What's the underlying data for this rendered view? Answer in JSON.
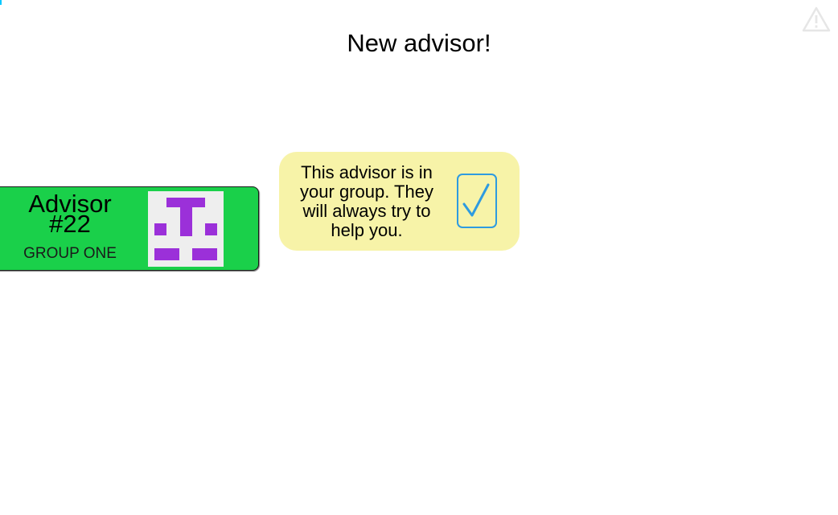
{
  "header": {
    "title": "New advisor!",
    "warning_icon": "warning-triangle-icon"
  },
  "advisor": {
    "name": "Advisor #22",
    "group": "GROUP ONE",
    "card_color": "#1ad04a",
    "avatar": {
      "icon": "pixel-glyph-avatar",
      "foreground": "#9b30d9",
      "background": "#eeeeee"
    }
  },
  "info": {
    "message": "This advisor is in your group. They will always try to help you.",
    "bubble_color": "#f7f3a8",
    "check_icon": "checkmark-icon",
    "check_color": "#2e9be0"
  }
}
